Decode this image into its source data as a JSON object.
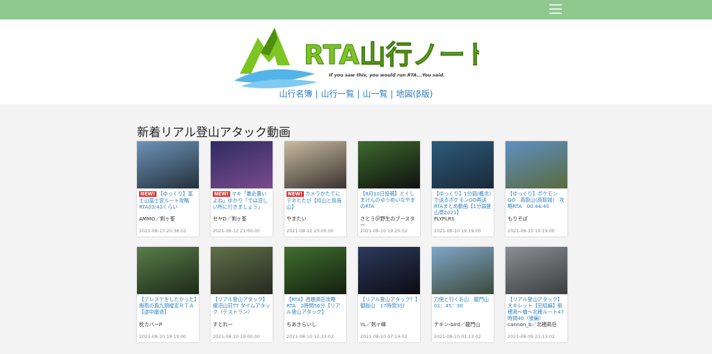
{
  "site": {
    "logo_title": "RTA山行ノート",
    "logo_tagline": "If you saw this, you would run RTA...You said."
  },
  "nav": {
    "items": [
      "山行名簿",
      "山行一覧",
      "山一覧",
      "地図(β版)"
    ]
  },
  "section": {
    "title": "新着リアル登山アタック動画"
  },
  "badge_label": "NEW!",
  "videos": [
    {
      "title": "【ゆっくり】富士山富士宮ルート攻略RTA03:43くらい",
      "is_new": true,
      "author": "AMMO／剣ヶ峯",
      "date": "2021-08-13 20:38:02",
      "thumb": [
        "#6e93b8",
        "#24303c"
      ]
    },
    {
      "title": "マキ「最近暑いよね」ゆかり「では涼しい所に行きましょう」",
      "is_new": true,
      "author": "セヤD／剣ヶ峯",
      "date": "2021-08-12 21:00:00",
      "thumb": [
        "#2e2c62",
        "#7b4a8e"
      ]
    },
    {
      "title": "カメラかたてにテネヒたび【月山と鳥海山】",
      "is_new": true,
      "author": "やまたい",
      "date": "2021-08-12 20:00:00",
      "thumb": [
        "#c7bba0",
        "#3a3230"
      ]
    },
    {
      "title": "【8月10日投稿】とくしまけんのゆうめいなやまのRTA",
      "is_new": false,
      "author": "さとう＠野生のブースター",
      "date": "2021-08-10 19:20:02",
      "thumb": [
        "#3d6a2e",
        "#101010"
      ]
    },
    {
      "title": "【ゆっくり】1分弱(概念)で送るポケモンGO再送RTAまとめ動画【1分弱登山祭2021】",
      "is_new": false,
      "author": "PLYPLRS",
      "date": "2021-08-10 19:19:00",
      "thumb": [
        "#2d5a7a",
        "#1a2a38"
      ]
    },
    {
      "title": "【ゆっくり】ポケモンGO　高取山(高取城)　攻略RTA　00:44:40",
      "is_new": false,
      "author": "もりそば",
      "date": "2021-08-10 19:19:00",
      "thumb": [
        "#5e8fc2",
        "#5a6b3e"
      ]
    },
    {
      "title": "【デレステをしたかった】梅雨の真九頭縦走ＲＴＡ【途中撤退】",
      "is_new": false,
      "author": "枕カバーP",
      "date": "2021-08-10 19:19:00",
      "thumb": [
        "#5b7d4a",
        "#1c2a18"
      ]
    },
    {
      "title": "【リアル登山アタック】裾沼山荘TT タイムアタック（テストラン）",
      "is_new": false,
      "author": "すとれー",
      "date": "2021-08-10 19:00:00",
      "thumb": [
        "#5f7048",
        "#262a20"
      ]
    },
    {
      "title": "【RTA】西穂高岳攻略RTA　2時間56分【リアル登山アタック】",
      "is_new": false,
      "author": "ちあきらいし",
      "date": "2021-08-10 11:33:02",
      "thumb": [
        "#406f2e",
        "#15200f"
      ]
    },
    {
      "title": "【リアル登山アタック？】御獄山　17時間3分",
      "is_new": false,
      "author": "YL／剣ヶ峰",
      "date": "2021-08-10 07:14:02",
      "thumb": [
        "#2c3a5c",
        "#0c0c14"
      ]
    },
    {
      "title": "刀使と行くお山　龍門山　01：45：30",
      "is_new": false,
      "author": "チキン-bird／龍門山",
      "date": "2021-08-10 01:13:02",
      "thumb": [
        "#7fa6c8",
        "#3b4a3a"
      ]
    },
    {
      "title": "【リアル登山アタック】大キレット【完結編】新穂高～槍～北穂ルート47時間40（後編）",
      "is_new": false,
      "author": "cannon_b／北穂高岳",
      "date": "2021-08-09 21:13:02",
      "thumb": [
        "#8a8e92",
        "#3c3e40"
      ]
    }
  ]
}
